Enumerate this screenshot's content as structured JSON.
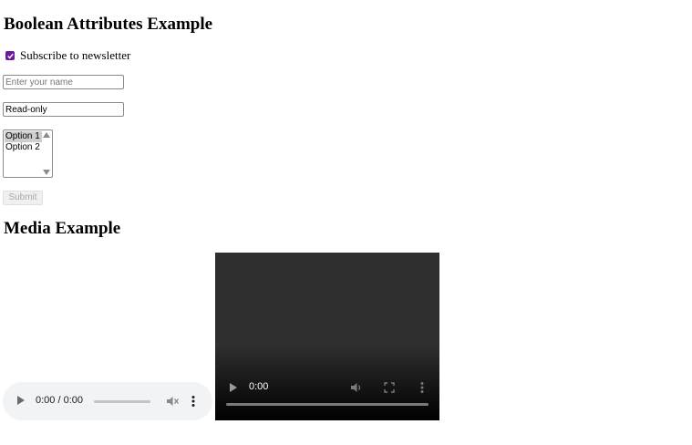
{
  "form_section": {
    "title": "Boolean Attributes Example",
    "checkbox": {
      "label": "Subscribe to newsletter",
      "checked": true,
      "accent_color": "#6a1b9a"
    },
    "name_input": {
      "placeholder": "Enter your name",
      "value": ""
    },
    "readonly_input": {
      "value": "Read-only"
    },
    "select": {
      "options": [
        "Option 1",
        "Option 2"
      ],
      "selected": "Option 1"
    },
    "submit_label": "Submit"
  },
  "media_section": {
    "title": "Media Example",
    "audio": {
      "time": "0:00 / 0:00",
      "icons": [
        "play-icon",
        "mute-icon",
        "more-options-icon"
      ]
    },
    "video": {
      "time": "0:00",
      "icons": [
        "play-icon",
        "volume-icon",
        "fullscreen-icon",
        "more-options-icon"
      ]
    }
  }
}
